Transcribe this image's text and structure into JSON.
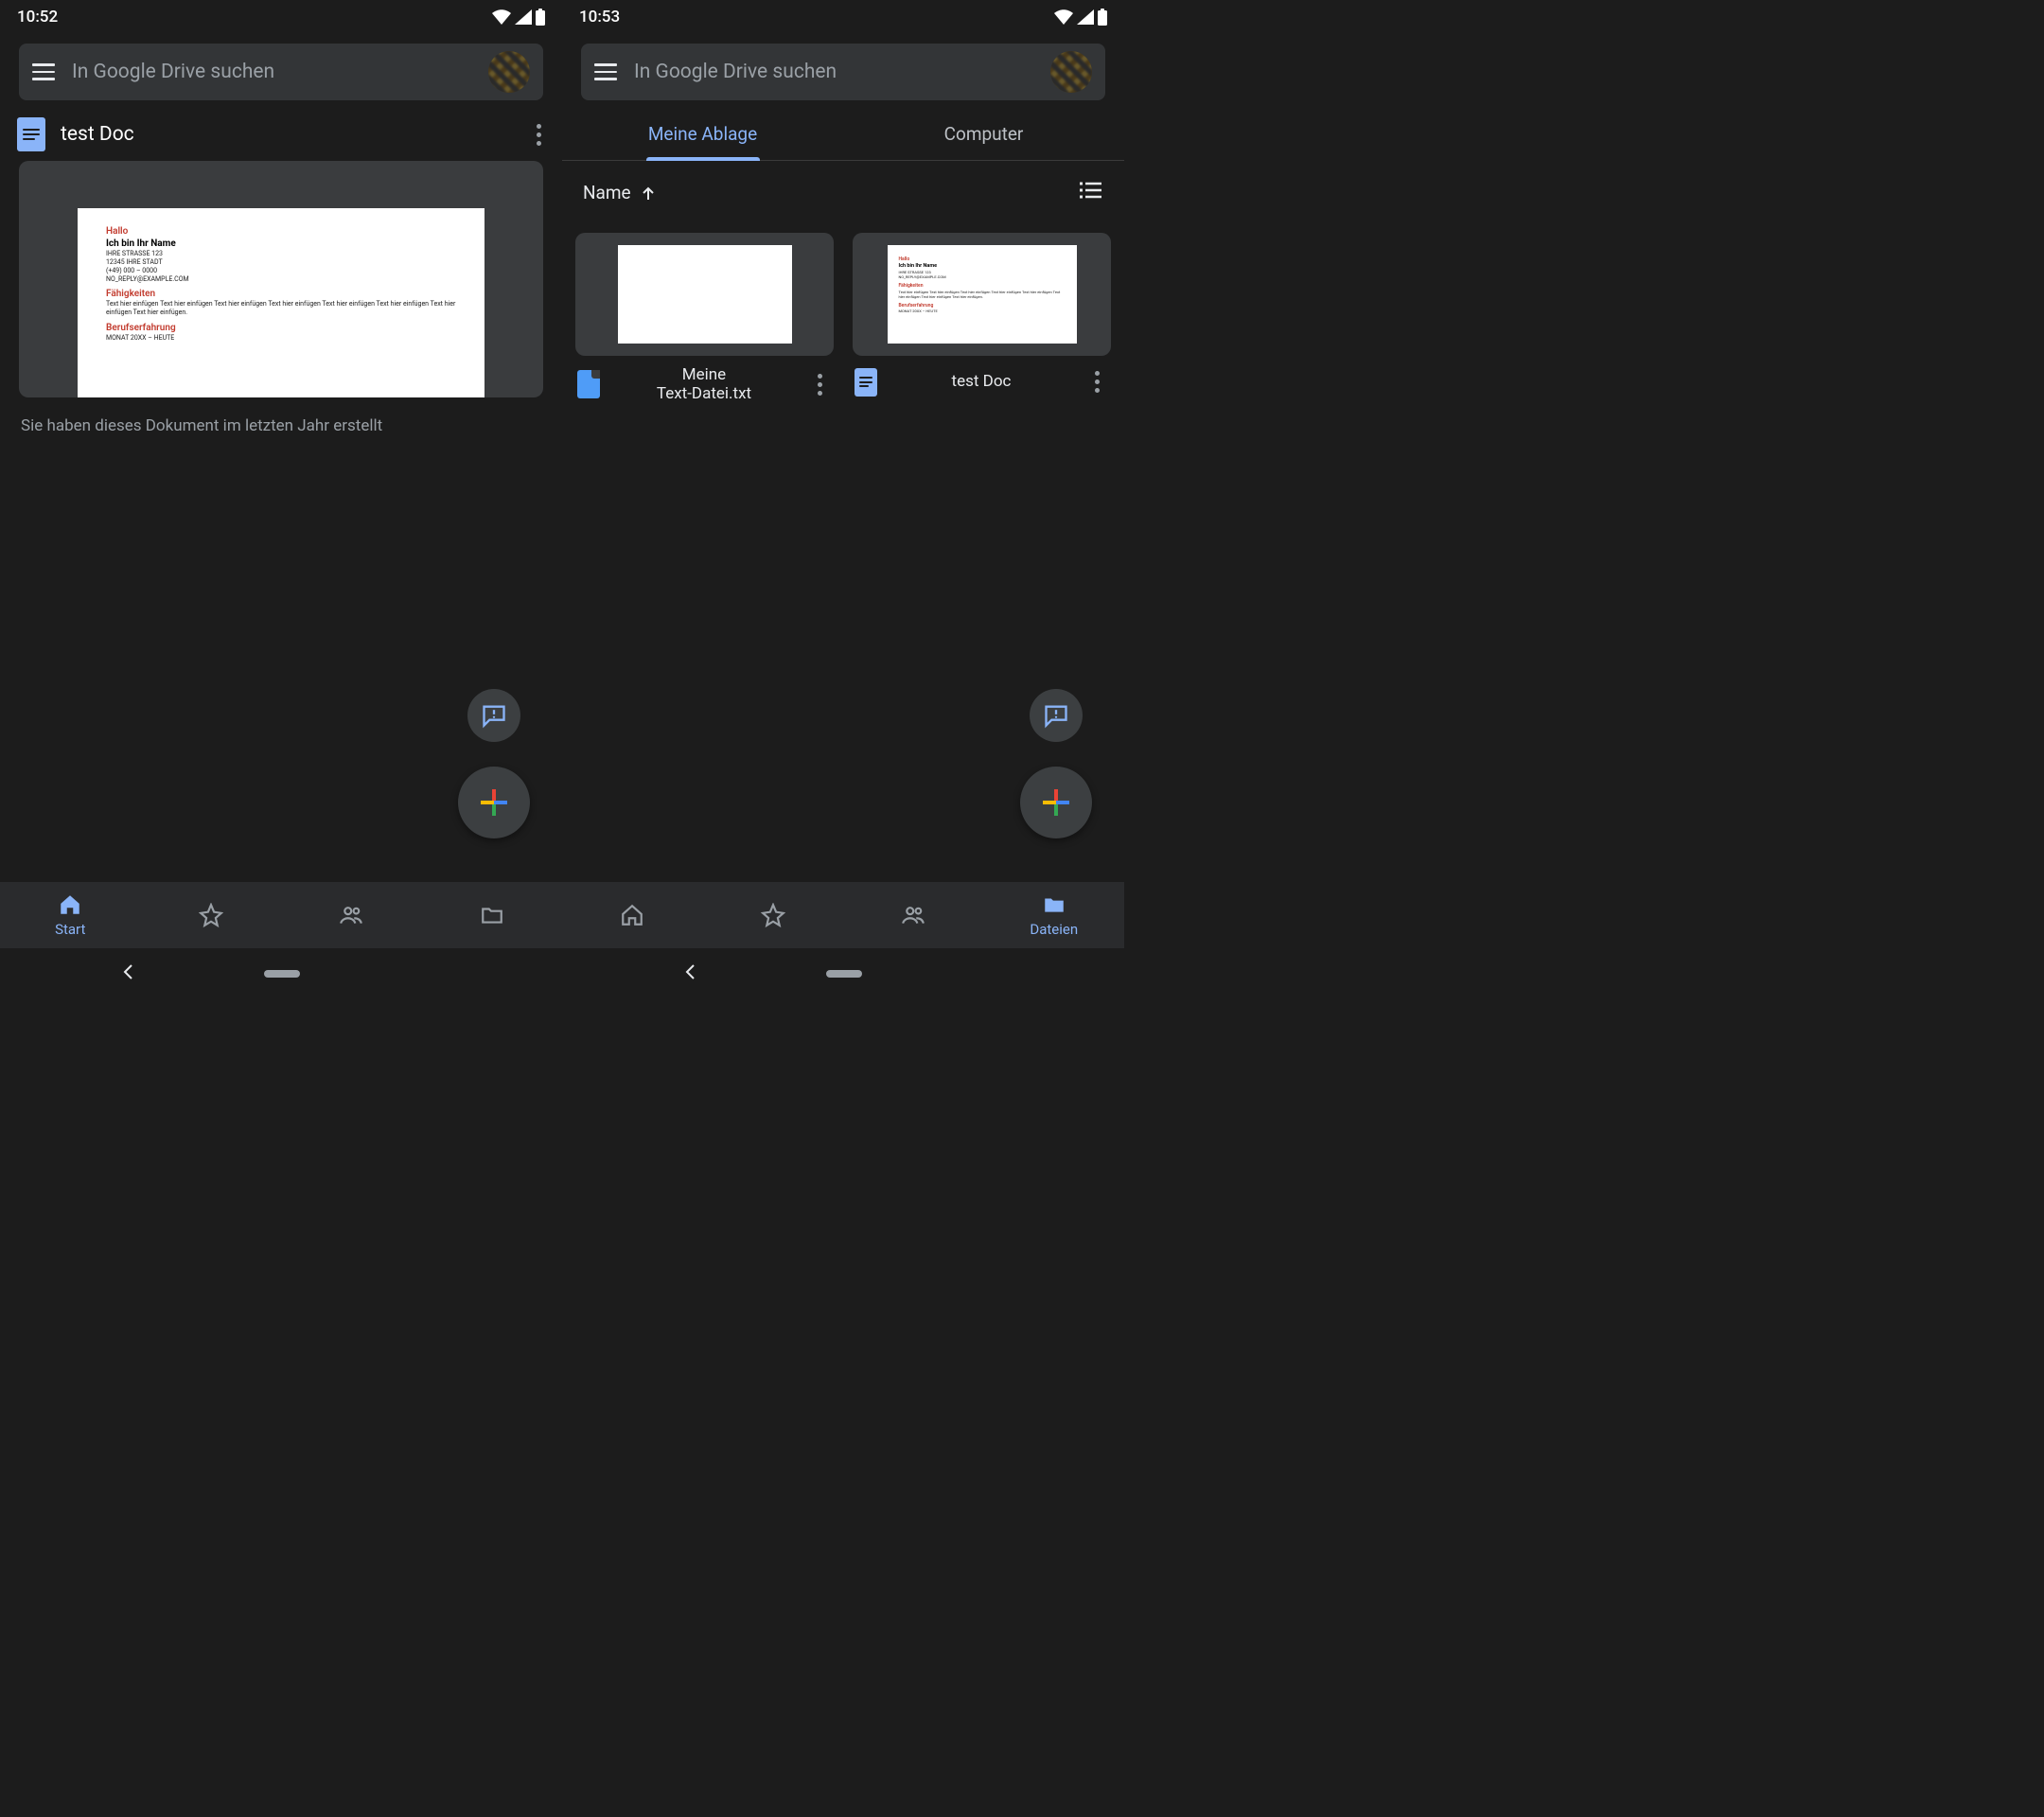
{
  "left": {
    "time": "10:52",
    "search": {
      "placeholder": "In Google Drive suchen"
    },
    "suggestion": {
      "title": "test Doc",
      "meta": "Sie haben dieses Dokument im letzten Jahr erstellt",
      "doc": {
        "l1": "Hallo",
        "l2": "Ich bin Ihr Name",
        "a1": "IHRE STRASSE 123",
        "a2": "12345 IHRE STADT",
        "a3": "(+49) 000 – 0000",
        "a4": "NO_REPLY@EXAMPLE.COM",
        "h2": "Fähigkeiten",
        "p1": "Text hier einfügen Text hier einfügen Text hier einfügen Text hier einfügen Text hier einfügen Text hier einfügen Text hier einfügen Text hier einfügen.",
        "h3": "Berufserfahrung",
        "p2": "MONAT 20XX – HEUTE"
      }
    },
    "nav": {
      "start": "Start"
    }
  },
  "right": {
    "time": "10:53",
    "search": {
      "placeholder": "In Google Drive suchen"
    },
    "tabs": {
      "drive": "Meine Ablage",
      "computer": "Computer"
    },
    "sort": "Name",
    "files": [
      {
        "name": "Meine\nText-Datei.txt"
      },
      {
        "name": "test Doc"
      }
    ],
    "nav": {
      "files": "Dateien"
    }
  }
}
